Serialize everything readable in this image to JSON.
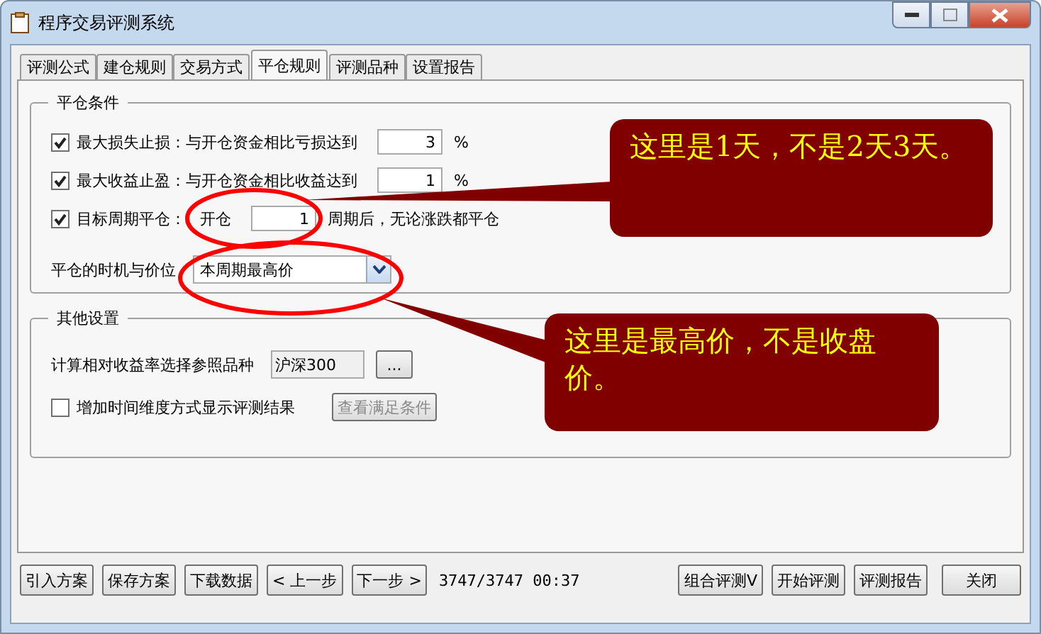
{
  "window": {
    "title": "程序交易评测系统"
  },
  "tabs": [
    {
      "label": "评测公式",
      "selected": false
    },
    {
      "label": "建仓规则",
      "selected": false
    },
    {
      "label": "交易方式",
      "selected": false
    },
    {
      "label": "平仓规则",
      "selected": true
    },
    {
      "label": "评测品种",
      "selected": false
    },
    {
      "label": "设置报告",
      "selected": false
    }
  ],
  "close_conditions": {
    "title": "平仓条件",
    "rows": [
      {
        "label": "最大损失止损：与开仓资金相比亏损达到",
        "checked": true,
        "value": "3",
        "suffix": "%"
      },
      {
        "label": "最大收益止盈：与开仓资金相比收益达到",
        "checked": true,
        "value": "1",
        "suffix": "%"
      },
      {
        "label": "目标周期平仓：",
        "prefix": "开仓",
        "checked": true,
        "value": "1",
        "suffix": "周期后，无论涨跌都平仓"
      }
    ],
    "timing": {
      "label": "平仓的时机与价位",
      "value": "本周期最高价"
    }
  },
  "other_settings": {
    "title": "其他设置",
    "reference": {
      "label": "计算相对收益率选择参照品种",
      "value": "沪深300",
      "button": "..."
    },
    "time_dimension": {
      "label": "增加时间维度方式显示评测结果",
      "checked": false,
      "button": "查看满足条件",
      "disabled": true
    }
  },
  "footer": {
    "buttons_left": [
      "引入方案",
      "保存方案",
      "下载数据",
      "< 上一步",
      "下一步 >"
    ],
    "status": "3747/3747 00:37",
    "buttons_right": [
      "组合评测V",
      "开始评测",
      "评测报告",
      "关闭"
    ]
  },
  "annotations": [
    {
      "text": "这里是1天，不是2天3天。"
    },
    {
      "text": "这里是最高价，不是收盘价。"
    }
  ]
}
